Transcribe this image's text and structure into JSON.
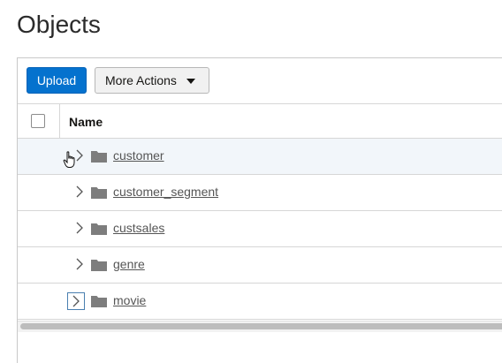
{
  "page": {
    "title": "Objects"
  },
  "toolbar": {
    "upload_label": "Upload",
    "more_actions_label": "More Actions"
  },
  "table": {
    "columns": {
      "name": "Name"
    },
    "rows": [
      {
        "name": "customer",
        "icon": "folder-icon",
        "state": "hover"
      },
      {
        "name": "customer_segment",
        "icon": "folder-icon"
      },
      {
        "name": "custsales",
        "icon": "folder-icon"
      },
      {
        "name": "genre",
        "icon": "folder-icon"
      },
      {
        "name": "movie",
        "icon": "folder-icon",
        "state": "focused"
      }
    ]
  },
  "colors": {
    "primary": "#0572ce",
    "row_hover": "#f2f6fa",
    "link": "#555555"
  }
}
